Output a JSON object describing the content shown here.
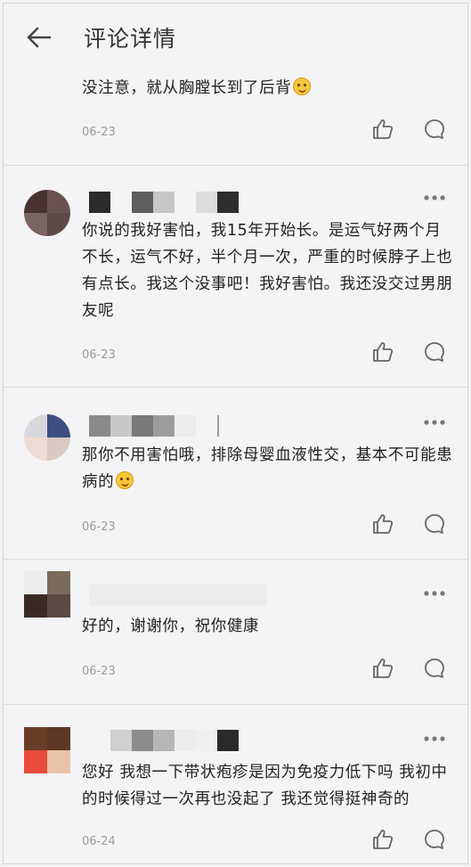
{
  "header": {
    "title": "评论详情",
    "back_icon": "arrow-left-icon"
  },
  "colors": {
    "background": "#f4f4f6",
    "date": "#9b9b9b",
    "icon": "#666666",
    "divider": "#dcdcde"
  },
  "top_reply": {
    "text": "没注意，就从胸膛长到了后背",
    "emoji": "laughing-emoji",
    "date": "06-23"
  },
  "comments": [
    {
      "text": "你说的我好害怕，我15年开始长。是运气好两个月不长，运气不好，半个月一次，严重的时候脖子上也有点长。我这个没事吧！我好害怕。我还没交过男朋友呢",
      "date": "06-23"
    },
    {
      "text": "那你不用害怕哦，排除母婴血液性交，基本不可能患病的",
      "emoji": "smile-emoji",
      "date": "06-23"
    },
    {
      "text": "好的，谢谢你，祝你健康",
      "date": "06-23"
    },
    {
      "text": "您好 我想一下带状疱疹是因为免疫力低下吗 我初中的时候得过一次再也没起了 我还觉得挺神奇的",
      "date": "06-24"
    }
  ]
}
